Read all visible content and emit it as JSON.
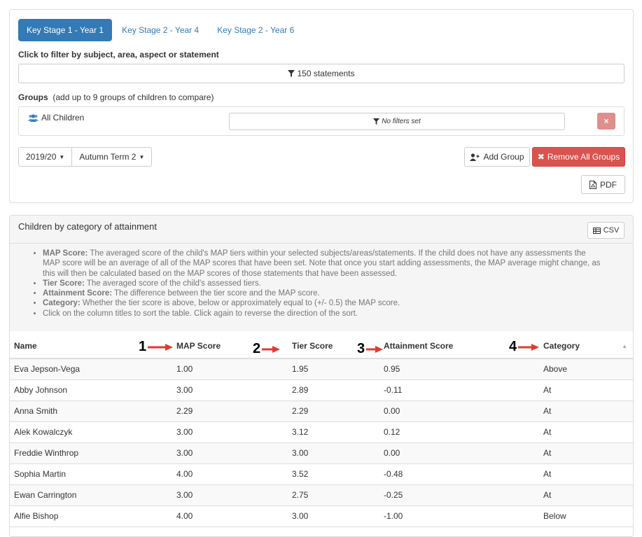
{
  "tabs": [
    "Key Stage 1 - Year 1",
    "Key Stage 2 - Year 4",
    "Key Stage 2 - Year 6"
  ],
  "filter": {
    "heading": "Click to filter by subject, area, aspect or statement",
    "statements_label": "150 statements"
  },
  "groups": {
    "heading_bold": "Groups",
    "heading_note": "(add up to 9 groups of children to compare)",
    "row": {
      "name": "All Children",
      "filter_label": "No filters set",
      "remove_label": "×"
    }
  },
  "controls": {
    "year": "2019/20",
    "term": "Autumn Term 2",
    "add_group": "Add Group",
    "remove_all": "Remove All Groups",
    "pdf": "PDF"
  },
  "attainment": {
    "title": "Children by category of attainment",
    "csv": "CSV",
    "notes": [
      {
        "term": "MAP Score:",
        "text": " The averaged score of the child's MAP tiers within your selected subjects/areas/statements. If the child does not have any assessments the MAP score will be an average of all of the MAP scores that have been set. Note that once you start adding assessments, the MAP average might change, as this will then be calculated based on the MAP scores of those statements that have been assessed."
      },
      {
        "term": "Tier Score:",
        "text": " The averaged score of the child's assessed tiers."
      },
      {
        "term": "Attainment Score:",
        "text": " The difference between the tier score and the MAP score."
      },
      {
        "term": "Category:",
        "text": " Whether the tier score is above, below or approximately equal to (+/- 0.5) the MAP score."
      },
      {
        "term": "",
        "text": "Click on the column titles to sort the table. Click again to reverse the direction of the sort."
      }
    ],
    "columns": [
      "Name",
      "MAP Score",
      "Tier Score",
      "Attainment Score",
      "Category"
    ],
    "annotations": [
      "1",
      "2",
      "3",
      "4"
    ],
    "rows": [
      [
        "Eva Jepson-Vega",
        "1.00",
        "1.95",
        "0.95",
        "Above"
      ],
      [
        "Abby Johnson",
        "3.00",
        "2.89",
        "-0.11",
        "At"
      ],
      [
        "Anna Smith",
        "2.29",
        "2.29",
        "0.00",
        "At"
      ],
      [
        "Alek Kowalczyk",
        "3.00",
        "3.12",
        "0.12",
        "At"
      ],
      [
        "Freddie Winthrop",
        "3.00",
        "3.00",
        "0.00",
        "At"
      ],
      [
        "Sophia Martin",
        "4.00",
        "3.52",
        "-0.48",
        "At"
      ],
      [
        "Ewan Carrington",
        "3.00",
        "2.75",
        "-0.25",
        "At"
      ],
      [
        "Alfie Bishop",
        "4.00",
        "3.00",
        "-1.00",
        "Below"
      ]
    ]
  },
  "colors": {
    "primary": "#337ab7",
    "danger": "#d9534f",
    "danger_light": "#e08e8b",
    "annotation_arrow": "#e23a2e"
  }
}
